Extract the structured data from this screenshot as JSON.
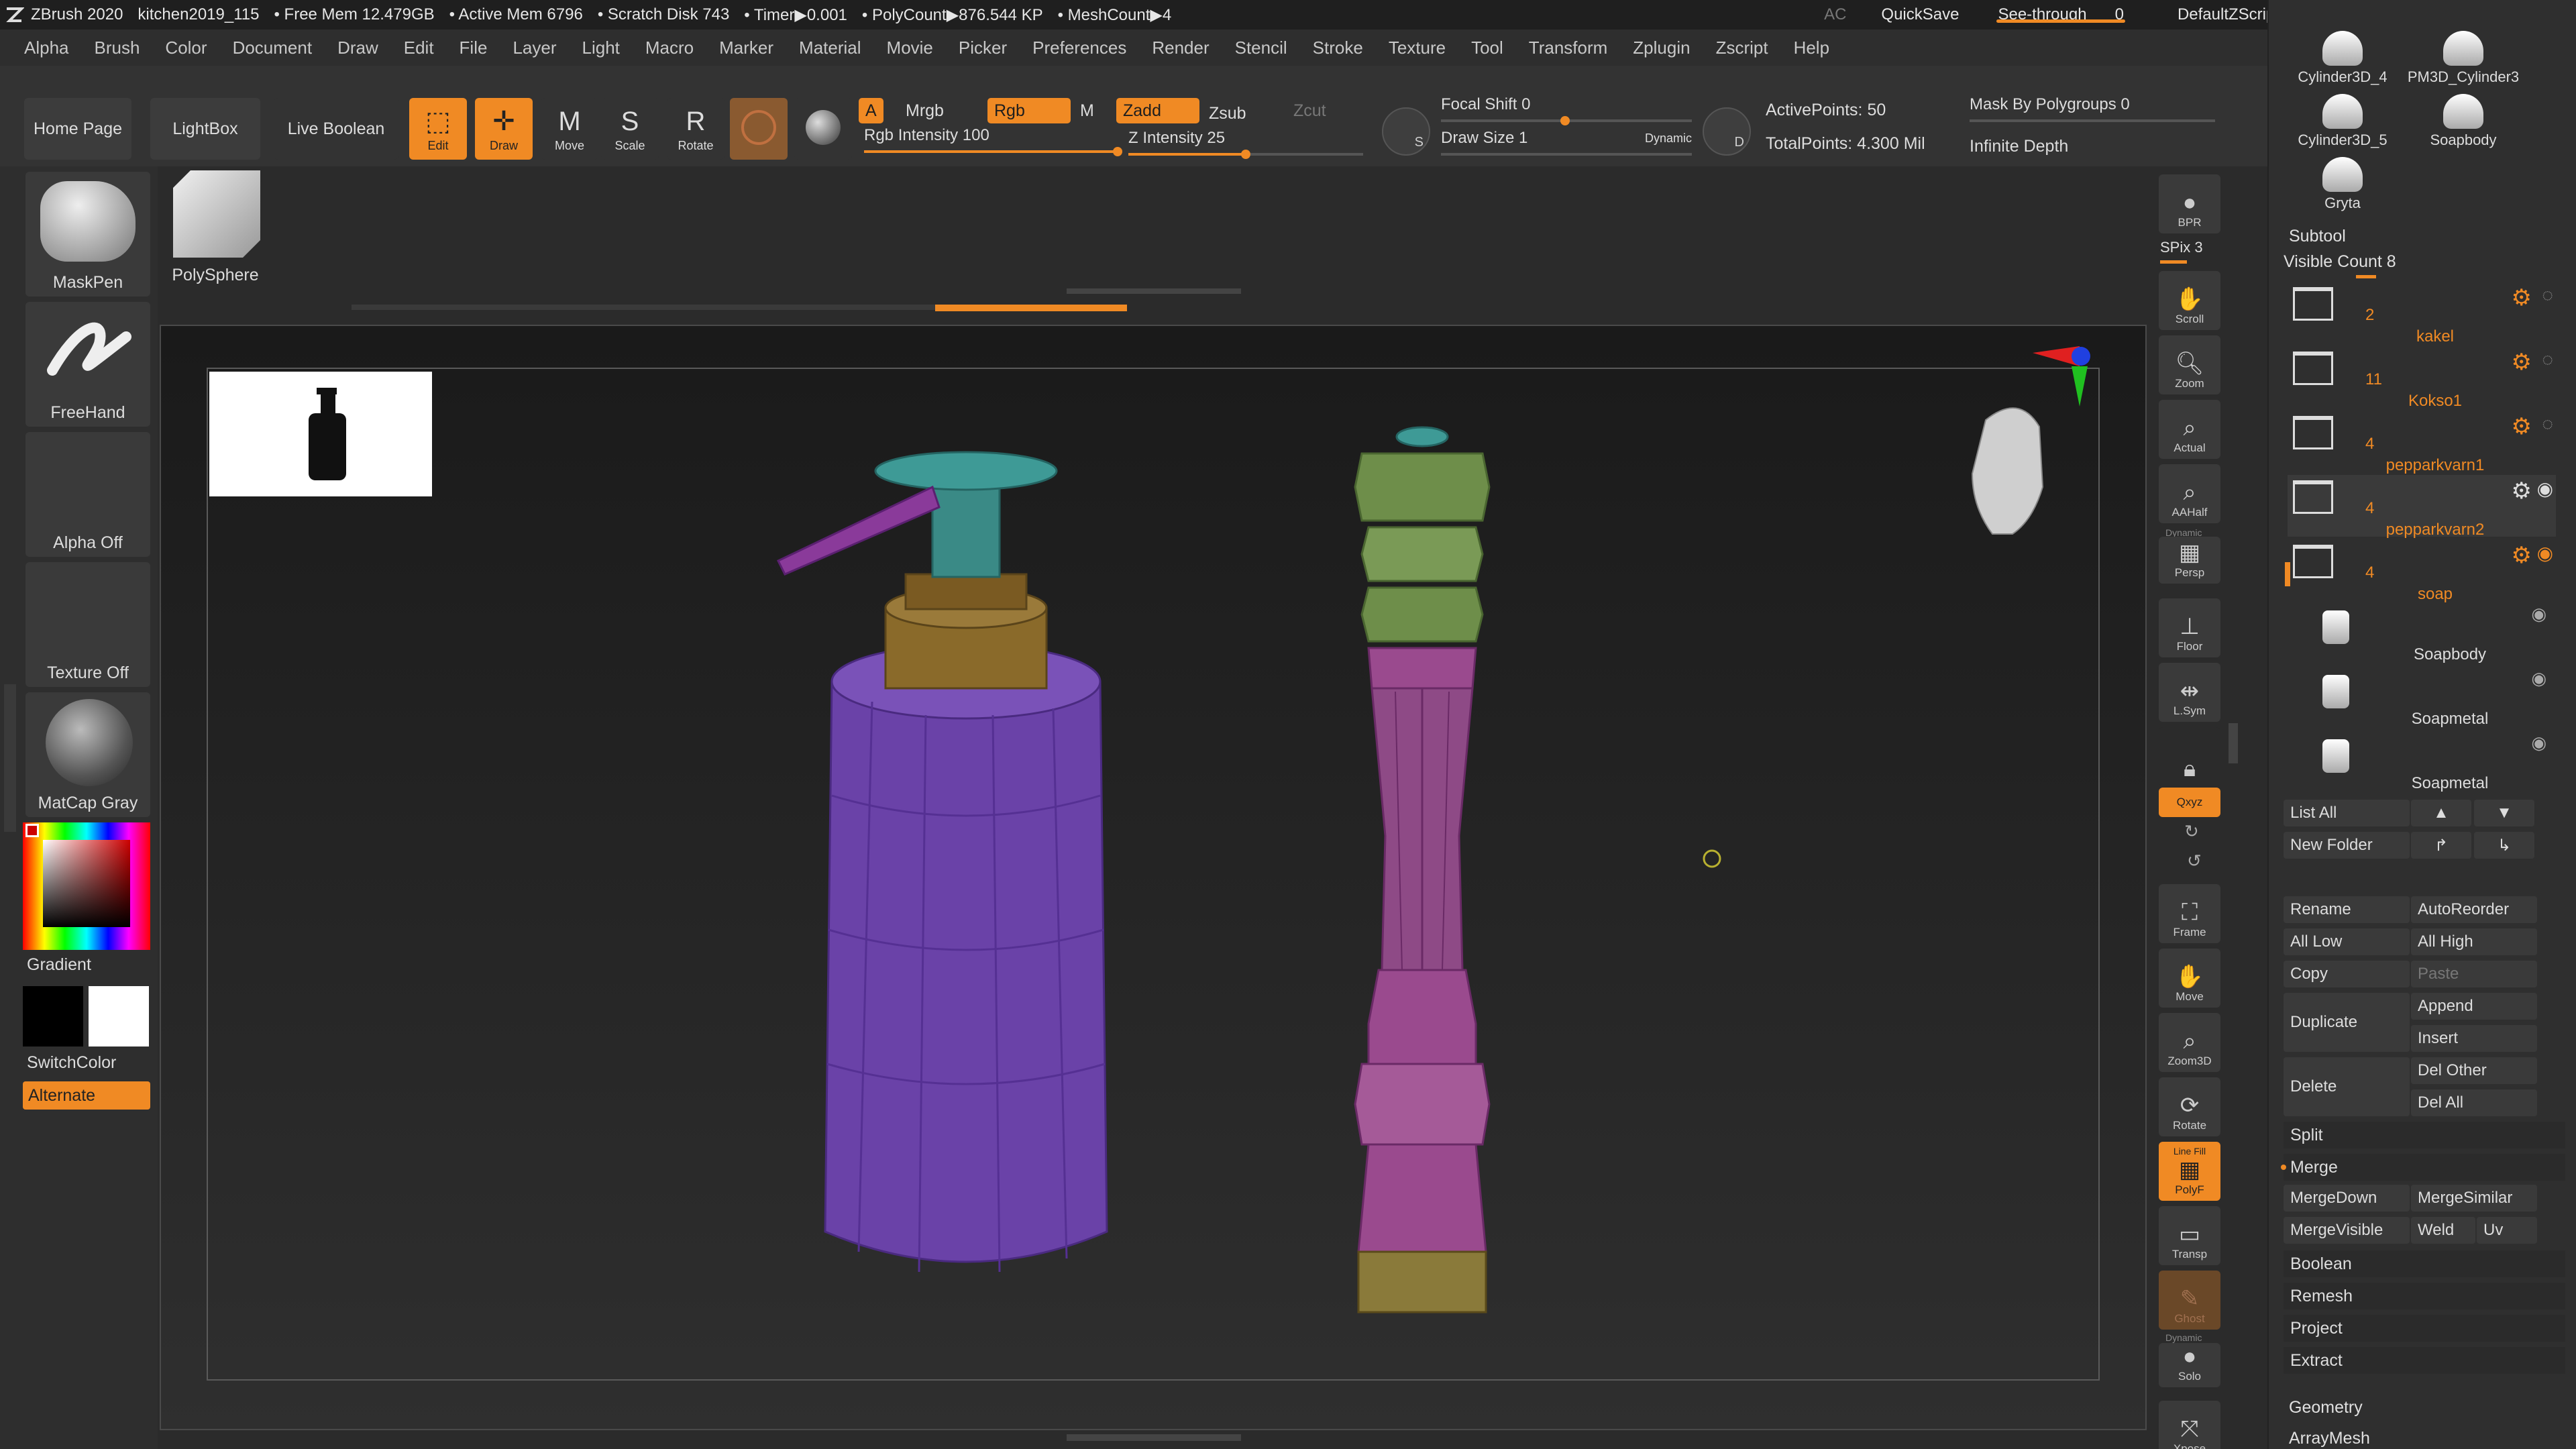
{
  "titlebar": {
    "app": "ZBrush 2020",
    "file": "kitchen2019_115",
    "stats": [
      "• Free Mem 12.479GB",
      "• Active Mem 6796",
      "• Scratch Disk 743",
      "• Timer▶0.001",
      "• PolyCount▶876.544 KP",
      "• MeshCount▶4"
    ],
    "ac": "AC",
    "quicksave": "QuickSave",
    "see_through_label": "See-through",
    "see_through_value": "0",
    "default_zscript": "DefaultZScript"
  },
  "menu": [
    "Alpha",
    "Brush",
    "Color",
    "Document",
    "Draw",
    "Edit",
    "File",
    "Layer",
    "Light",
    "Macro",
    "Marker",
    "Material",
    "Movie",
    "Picker",
    "Preferences",
    "Render",
    "Stencil",
    "Stroke",
    "Texture",
    "Tool",
    "Transform",
    "Zplugin",
    "Zscript",
    "Help"
  ],
  "shelf": {
    "home_page": "Home Page",
    "lightbox": "LightBox",
    "live_boolean": "Live Boolean",
    "edit": "Edit",
    "draw": "Draw",
    "move": "Move",
    "scale": "Scale",
    "rotate": "Rotate",
    "a": "A",
    "mrgb": "Mrgb",
    "rgb": "Rgb",
    "m": "M",
    "zadd": "Zadd",
    "zsub": "Zsub",
    "zcut": "Zcut",
    "rgb_intensity_label": "Rgb Intensity",
    "rgb_intensity_value": "100",
    "rgb_intensity_level": 1.0,
    "z_intensity_label": "Z Intensity",
    "z_intensity_value": "25",
    "z_intensity_level": 0.5,
    "focal_shift_label": "Focal Shift",
    "focal_shift_value": "0",
    "draw_size_label": "Draw Size",
    "draw_size_value": "1",
    "dynamic": "Dynamic",
    "active_points": "ActivePoints: 50",
    "total_points": "TotalPoints: 4.300 Mil",
    "mask_by_polygroups": "Mask By Polygroups 0",
    "infinite_depth": "Infinite Depth"
  },
  "left": {
    "brush": "MaskPen",
    "stroke": "FreeHand",
    "alpha": "Alpha Off",
    "texture": "Texture Off",
    "material": "MatCap Gray",
    "gradient": "Gradient",
    "switchcolor": "SwitchColor",
    "alternate": "Alternate",
    "polysphere": "PolySphere"
  },
  "rightcol": {
    "bpr": "BPR",
    "spix": "SPix 3",
    "scroll": "Scroll",
    "zoom": "Zoom",
    "actual": "Actual",
    "aahalf": "AAHalf",
    "dynamic": "Dynamic",
    "persp": "Persp",
    "floor": "Floor",
    "lsym": "L.Sym",
    "xyz": "Qxyz",
    "frame": "Frame",
    "move": "Move",
    "zoom3d": "Zoom3D",
    "rotate": "Rotate",
    "line_fill": "Line Fill",
    "polyf": "PolyF",
    "transp": "Transp",
    "ghost": "Ghost",
    "solo_dynamic": "Dynamic",
    "solo": "Solo",
    "xpose": "Xpose"
  },
  "rightpanel": {
    "thumbs": [
      "Cylinder3D_4",
      "PM3D_Cylinder3",
      "Cylinder3D_5",
      "Soapbody",
      "Gryta"
    ],
    "subtool": "Subtool",
    "visible_count": "Visible Count 8",
    "folders": [
      {
        "num": "2",
        "name": "kakel"
      },
      {
        "num": "11",
        "name": "Kokso1"
      },
      {
        "num": "4",
        "name": "pepparkvarn1"
      },
      {
        "num": "4",
        "name": "pepparkvarn2"
      },
      {
        "num": "4",
        "name": "soap"
      }
    ],
    "children": [
      "Soapbody",
      "Soapmetal",
      "Soapmetal"
    ],
    "buttons": {
      "list_all": "List All",
      "new_folder": "New Folder",
      "rename": "Rename",
      "autoreorder": "AutoReorder",
      "all_low": "All Low",
      "all_high": "All High",
      "copy": "Copy",
      "paste": "Paste",
      "append": "Append",
      "duplicate": "Duplicate",
      "insert": "Insert",
      "delete": "Delete",
      "del_other": "Del Other",
      "del_all": "Del All",
      "split": "Split",
      "merge": "Merge",
      "mergedown": "MergeDown",
      "mergesimilar": "MergeSimilar",
      "mergevisible": "MergeVisible",
      "weld": "Weld",
      "uv": "Uv",
      "boolean": "Boolean",
      "remesh": "Remesh",
      "project": "Project",
      "extract": "Extract",
      "geometry": "Geometry",
      "arraymesh": "ArrayMesh"
    }
  },
  "colors": {
    "accent": "#f08a24",
    "bottle_body": "#6a42a8",
    "bottle_neck": "#8a6a2a",
    "pump": "#3a8a86",
    "mill_top": "#6e8e4a",
    "mill_body": "#8e4a86",
    "mill_base": "#8a7a3a"
  }
}
